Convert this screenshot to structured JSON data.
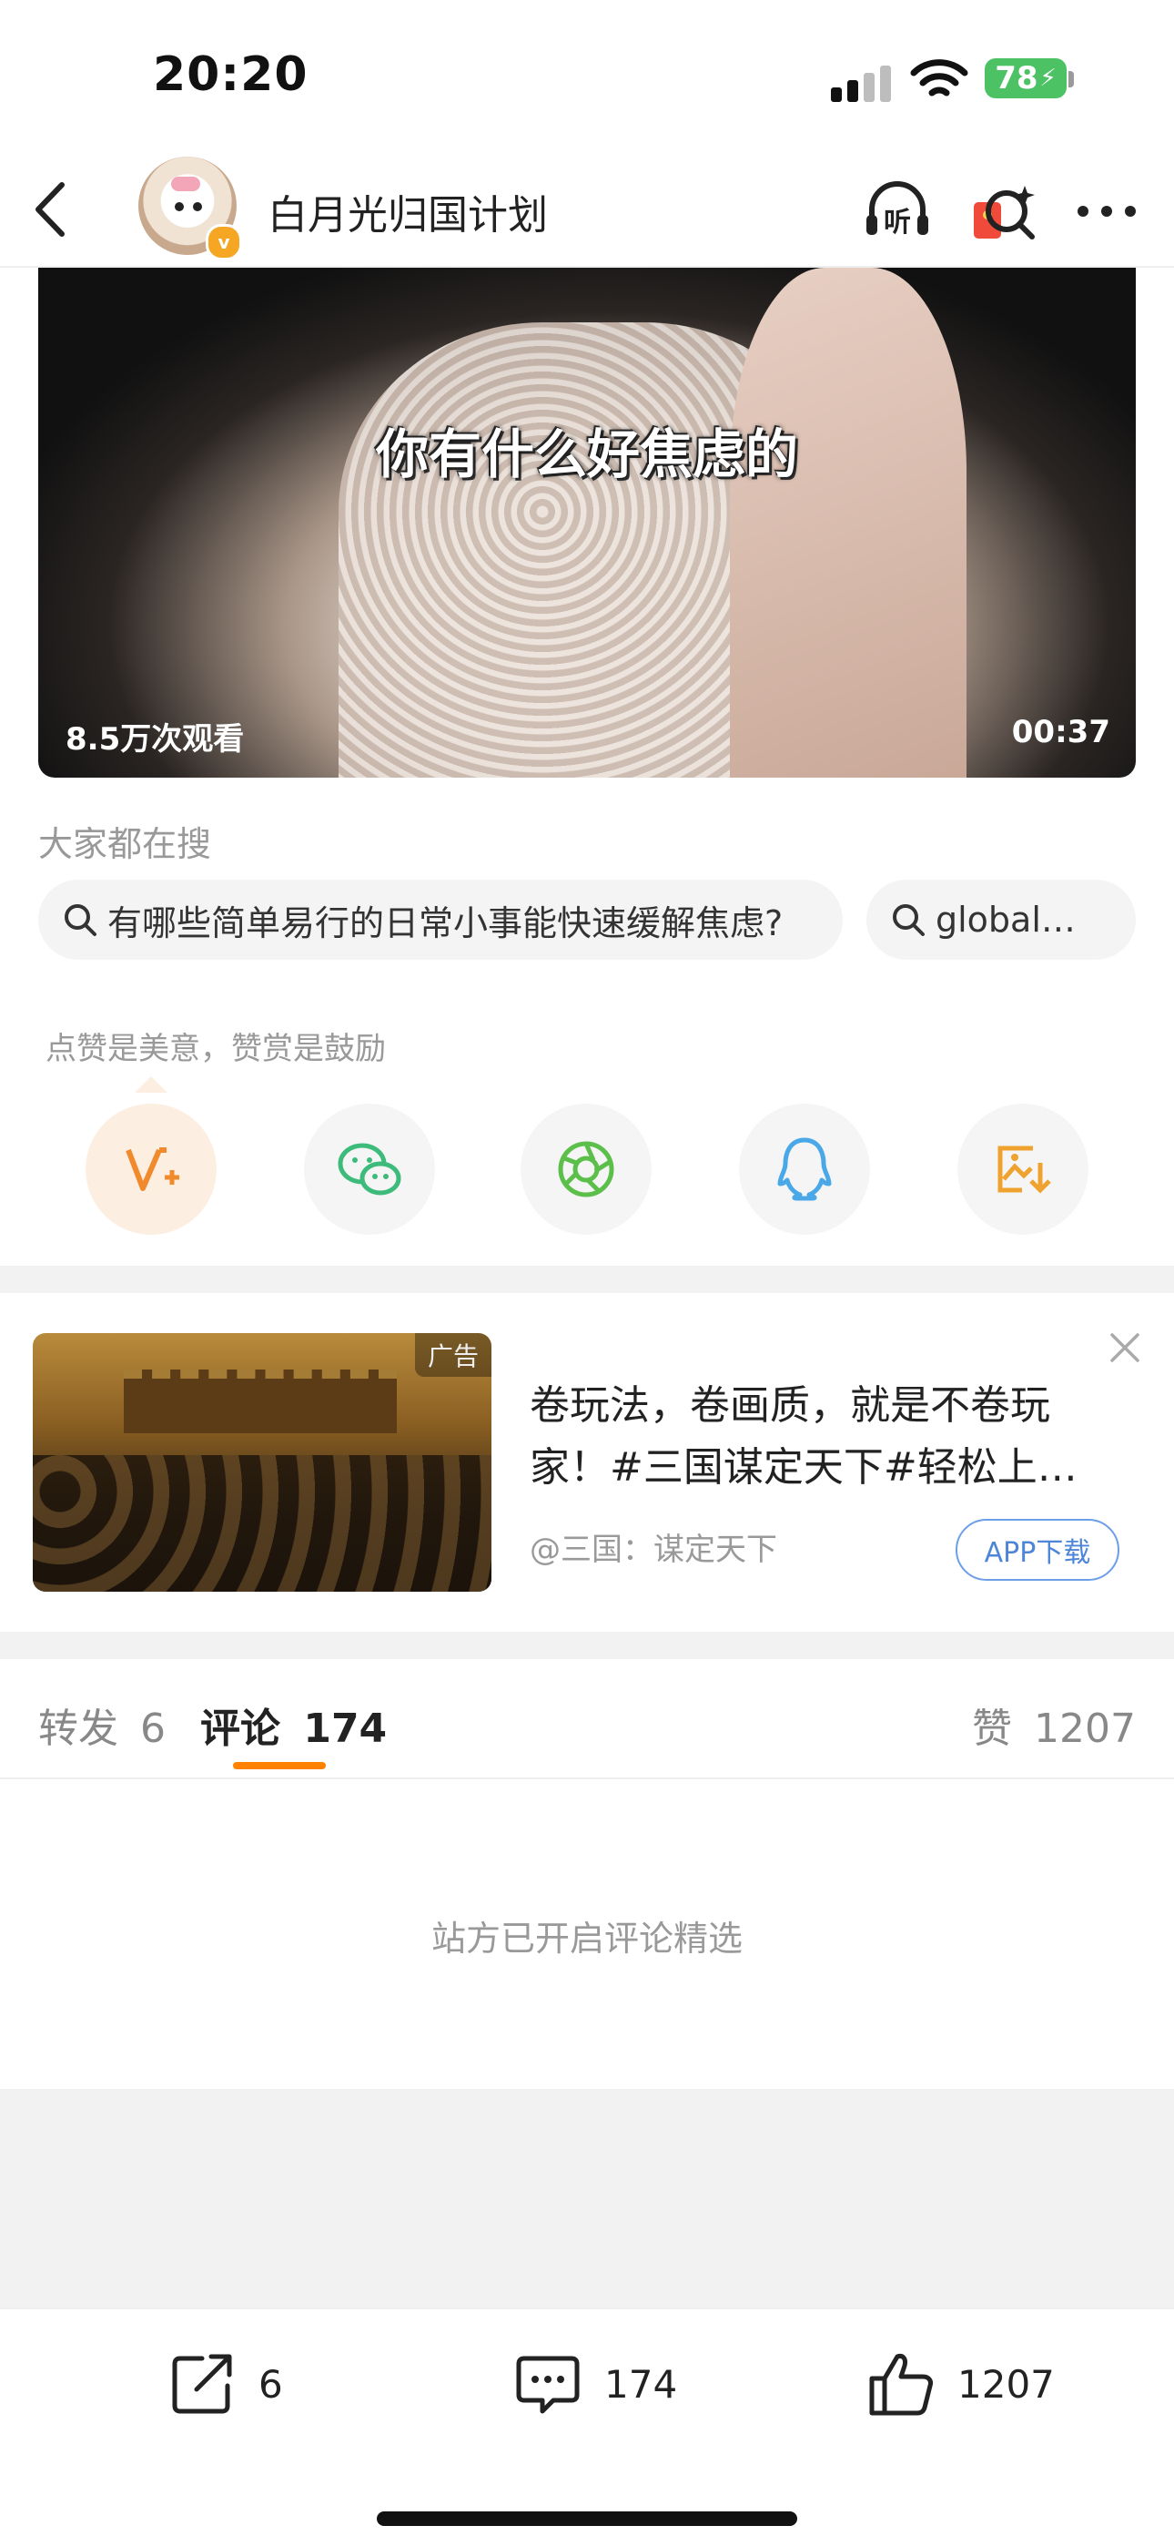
{
  "status_bar": {
    "time": "20:20",
    "battery": "78"
  },
  "nav": {
    "title": "白月光归国计划",
    "icons": [
      "back-icon",
      "listen-icon",
      "red-packet-search-icon",
      "more-icon"
    ],
    "listen_label": "听"
  },
  "video": {
    "caption": "你有什么好焦虑的",
    "views": "8.5万次观看",
    "duration": "00:37"
  },
  "search_suggest": {
    "label": "大家都在搜",
    "items": [
      "有哪些简单易行的日常小事能快速缓解焦虑?",
      "global…"
    ]
  },
  "reward": {
    "hint": "点赞是美意，赞赏是鼓励",
    "share_targets": [
      "reward-icon",
      "wechat-icon",
      "moments-icon",
      "qq-icon",
      "save-image-icon"
    ]
  },
  "ad": {
    "tag": "广告",
    "text": "卷玩法，卷画质，就是不卷玩家！#三国谋定天下#轻松上…",
    "source": "@三国：谋定天下",
    "button": "APP下载"
  },
  "tabs": {
    "repost": {
      "label": "转发",
      "count": "6"
    },
    "comment": {
      "label": "评论",
      "count": "174"
    },
    "like": {
      "label": "赞",
      "count": "1207"
    }
  },
  "comment_note": "站方已开启评论精选",
  "bottom_bar": {
    "share_count": "6",
    "comment_count": "174",
    "like_count": "1207"
  },
  "colors": {
    "accent": "#ff8200",
    "battery": "#4cc265",
    "link_blue": "#4d86d9"
  }
}
